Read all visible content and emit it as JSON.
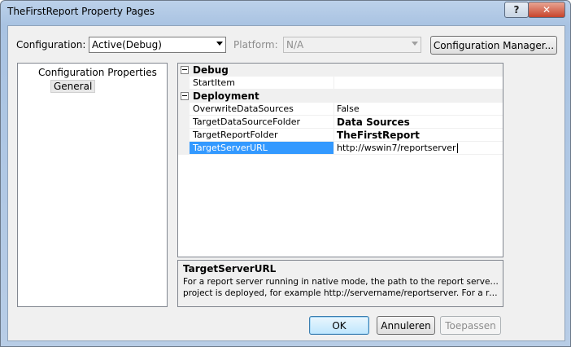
{
  "window": {
    "title": "TheFirstReport Property Pages",
    "help_label": "?",
    "close_label": "✕"
  },
  "toolbar": {
    "configuration_label": "Configuration:",
    "configuration_value": "Active(Debug)",
    "platform_label": "Platform:",
    "platform_value": "N/A",
    "config_manager_label": "Configuration Manager..."
  },
  "tree": {
    "root_label": "Configuration Properties",
    "child_label": "General"
  },
  "grid": {
    "categories": [
      {
        "label": "Debug",
        "properties": [
          {
            "name": "StartItem",
            "value": ""
          }
        ]
      },
      {
        "label": "Deployment",
        "properties": [
          {
            "name": "OverwriteDataSources",
            "value": "False"
          },
          {
            "name": "TargetDataSourceFolder",
            "value": "Data Sources"
          },
          {
            "name": "TargetReportFolder",
            "value": "TheFirstReport"
          },
          {
            "name": "TargetServerURL",
            "value": "http://wswin7/reportserver"
          }
        ]
      }
    ]
  },
  "description": {
    "title": "TargetServerURL",
    "line1": "For a report server running in native mode, the path to the report server where the",
    "line2": "project is deployed, for example http://servername/reportserver.  For a report ser..."
  },
  "buttons": {
    "ok_label": "OK",
    "cancel_label": "Annuleren",
    "apply_label": "Toepassen"
  }
}
